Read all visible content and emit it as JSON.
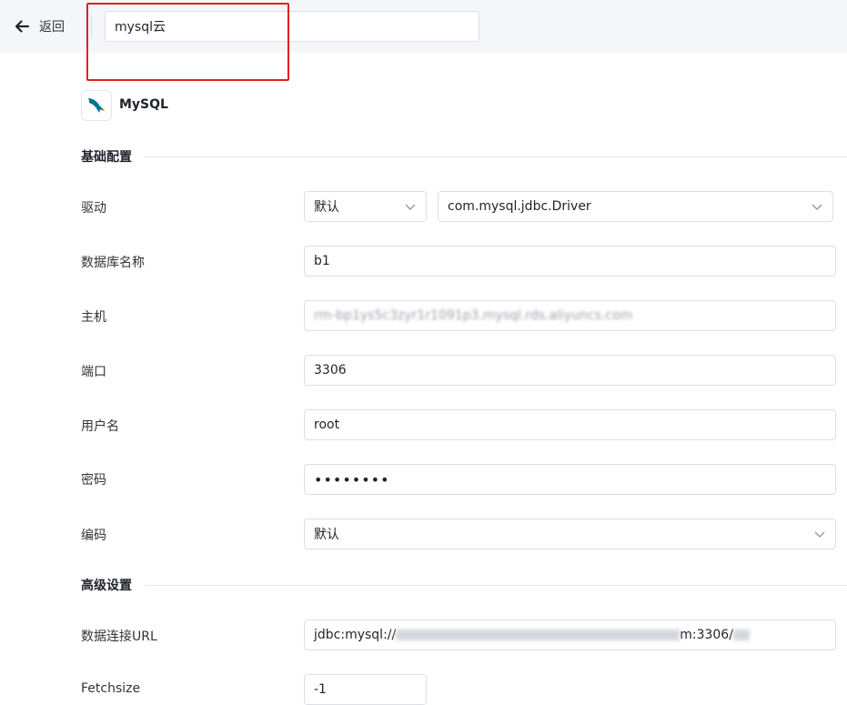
{
  "header": {
    "back_label": "返回",
    "name_value": "mysql云"
  },
  "datasource": {
    "type_name": "MySQL"
  },
  "sections": {
    "basic": "基础配置",
    "advanced": "高级设置"
  },
  "form": {
    "driver": {
      "label": "驱动",
      "mode": "默认",
      "class": "com.mysql.jdbc.Driver"
    },
    "database": {
      "label": "数据库名称",
      "value": "b1"
    },
    "host": {
      "label": "主机",
      "value": "rm-bp1ys5c3zyr1r1091p3.mysql.rds.aliyuncs.com"
    },
    "port": {
      "label": "端口",
      "value": "3306"
    },
    "username": {
      "label": "用户名",
      "value": "root"
    },
    "password": {
      "label": "密码",
      "value": "••••••••"
    },
    "encoding": {
      "label": "编码",
      "value": "默认"
    },
    "url": {
      "label": "数据连接URL",
      "prefix": "jdbc:mysql://",
      "suffix": "m:3306/"
    },
    "fetchsize": {
      "label": "Fetchsize",
      "value": "-1"
    }
  },
  "colors": {
    "accent": "#e02020",
    "logo_blue": "#00758f"
  },
  "icons": {
    "back": "arrow-left-icon",
    "dropdown": "chevron-down-icon",
    "logo": "mysql-dolphin-icon"
  }
}
